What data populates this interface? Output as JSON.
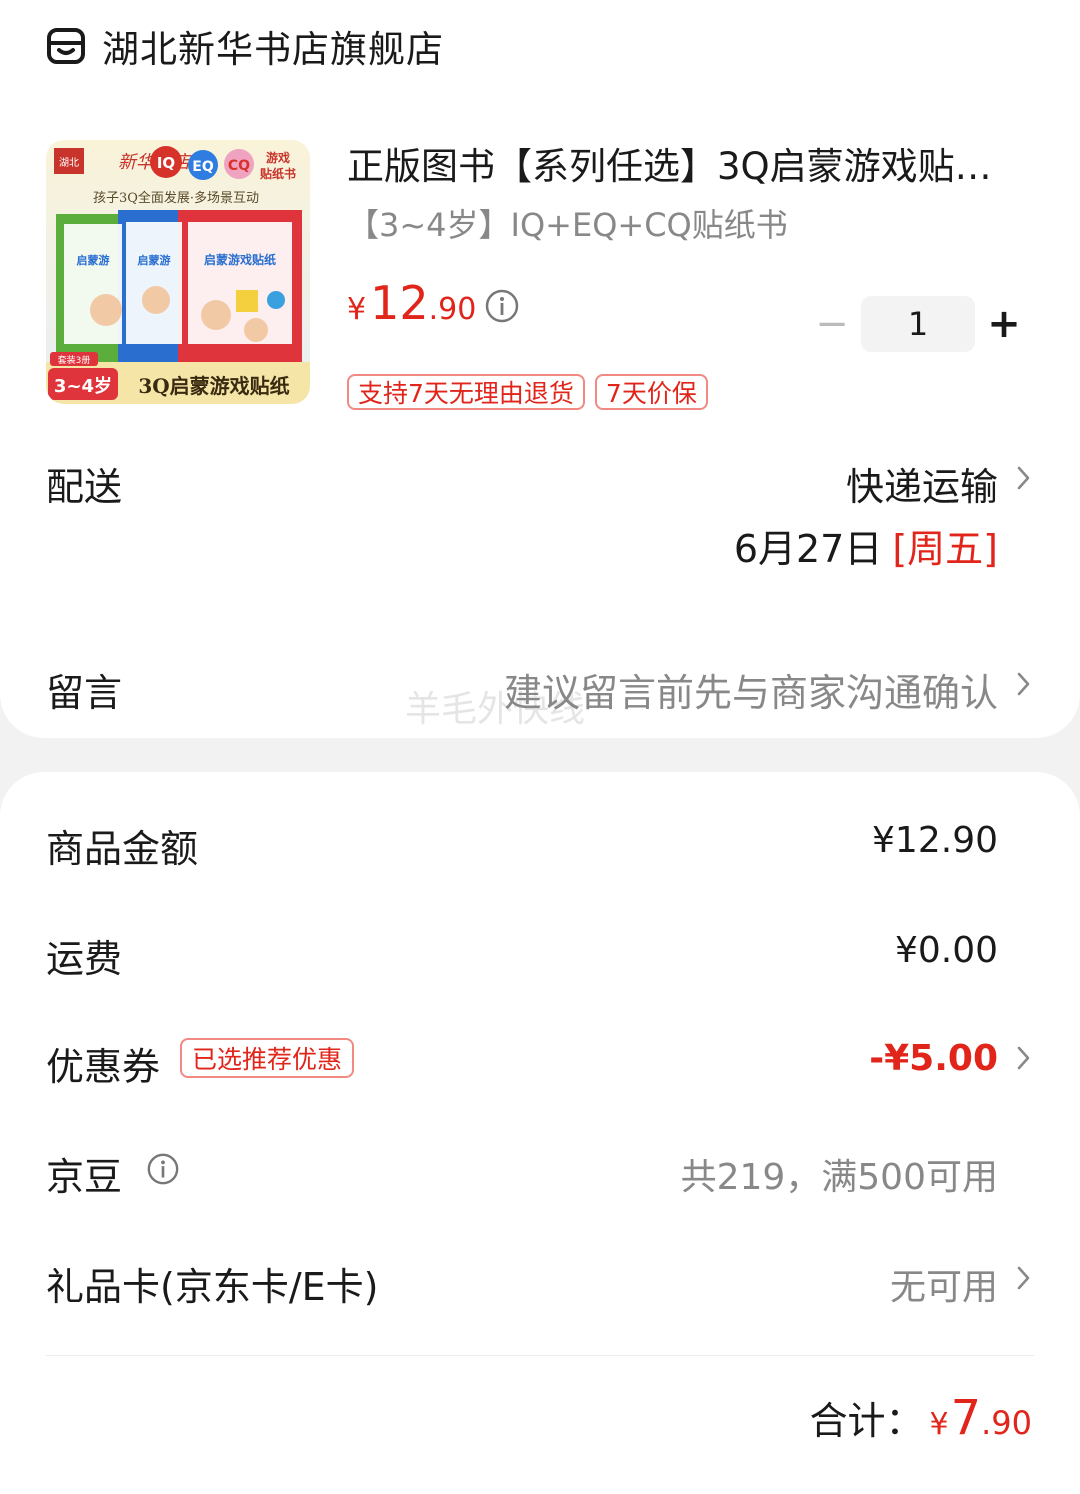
{
  "shop": {
    "name": "湖北新华书店旗舰店",
    "icon": "shop-icon"
  },
  "product": {
    "title": "正版图书【系列任选】3Q启蒙游戏贴…",
    "spec": "【3~4岁】IQ+EQ+CQ贴纸书",
    "price_currency": "¥",
    "price_integer": "12",
    "price_decimal": ".90",
    "quantity": "1",
    "tags": [
      "支持7天无理由退货",
      "7天价保"
    ],
    "image_text": {
      "publisher": "新华书店",
      "tag1": "IQ",
      "tag2": "EQ",
      "tag3": "CQ",
      "badge": "游戏贴纸书",
      "slogan": "孩子3Q全面发展·多场景互动",
      "banner_age": "3~4岁",
      "banner_title": "3Q启蒙游戏贴纸",
      "set_note": "套装3册"
    }
  },
  "delivery": {
    "label": "配送",
    "method": "快递运输",
    "date": "6月27日",
    "weekday": "[周五]"
  },
  "message": {
    "label": "留言",
    "placeholder": "建议留言前先与商家沟通确认"
  },
  "watermark": "羊毛外快线",
  "summary": {
    "goods_label": "商品金额",
    "goods_value": "¥12.90",
    "shipping_label": "运费",
    "shipping_value": "¥0.00",
    "coupon_label": "优惠券",
    "coupon_tag": "已选推荐优惠",
    "coupon_value": "-¥5.00",
    "beans_label": "京豆",
    "beans_value": "共219，满500可用",
    "giftcard_label": "礼品卡(京东卡/E卡)",
    "giftcard_value": "无可用"
  },
  "total": {
    "label": "合计：",
    "currency": "¥",
    "integer": "7",
    "decimal": ".90"
  },
  "colors": {
    "accent": "#e1251b",
    "muted": "#888888",
    "background": "#f2f2f2"
  }
}
